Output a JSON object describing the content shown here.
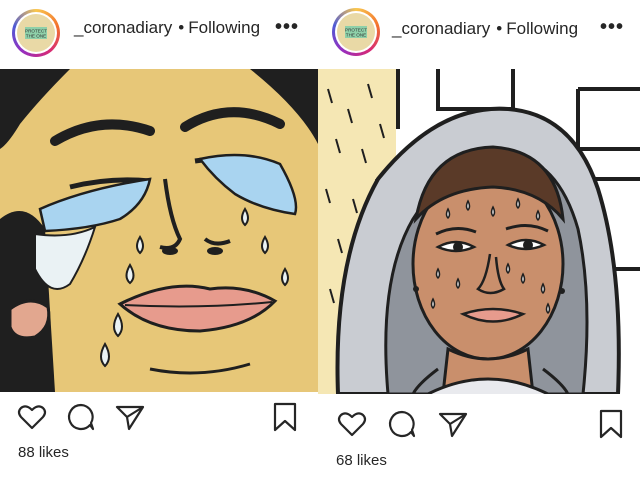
{
  "posts": [
    {
      "username": "_coronadiary",
      "separator": "•",
      "follow_status": "Following",
      "more": "•••",
      "avatar_text": [
        "PROTECT",
        "THE ONE"
      ],
      "likes": "88 likes",
      "image_description_icon": "crying-face-illustration"
    },
    {
      "username": "_coronadiary",
      "separator": "•",
      "follow_status": "Following",
      "more": "•••",
      "avatar_text": [
        "PROTECT",
        "THE ONE"
      ],
      "likes": "68 likes",
      "image_description_icon": "hooded-sweating-face-illustration"
    }
  ],
  "icons": [
    "heart-icon",
    "comment-icon",
    "share-icon",
    "bookmark-icon"
  ],
  "colors": {
    "skin_left": "#e7c778",
    "tear_blue": "#a9d4f0",
    "hood_gray": "#c9ccd2",
    "skin_right": "#c98f6c",
    "lips": "#e79b8d"
  }
}
